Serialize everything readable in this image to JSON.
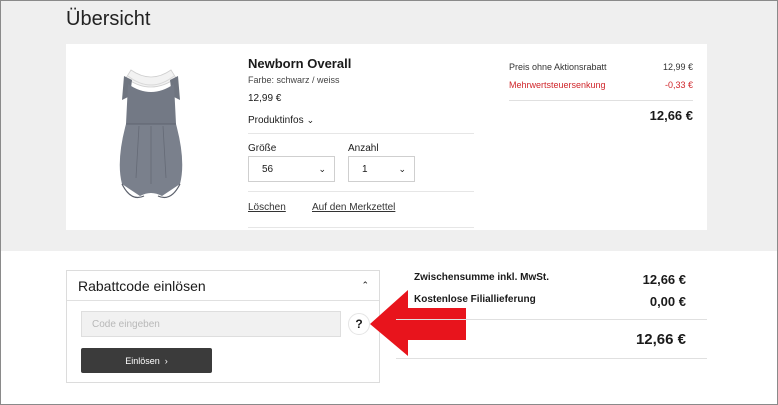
{
  "page": {
    "title": "Übersicht"
  },
  "product": {
    "name": "Newborn Overall",
    "color": "Farbe: schwarz / weiss",
    "price": "12,99 €",
    "infos_label": "Produktinfos",
    "size_label": "Größe",
    "size_value": "56",
    "qty_label": "Anzahl",
    "qty_value": "1",
    "delete_label": "Löschen",
    "wishlist_label": "Auf den Merkzettel",
    "image_icon": "baby-overall-image"
  },
  "price_breakdown": {
    "row1_label": "Preis ohne Aktionsrabatt",
    "row1_value": "12,99 €",
    "row2_label": "Mehrwertsteuersenkung",
    "row2_value": "-0,33 €",
    "total": "12,66 €"
  },
  "coupon": {
    "title": "Rabattcode einlösen",
    "placeholder": "Code eingeben",
    "help": "?",
    "button_label": "Einlösen"
  },
  "summary": {
    "subtotal_label": "Zwischensumme inkl. MwSt.",
    "subtotal_value": "12,66 €",
    "shipping_label": "Kostenlose Filiallieferung",
    "shipping_value": "0,00 €",
    "total": "12,66 €"
  },
  "colors": {
    "accent_red": "#d0262b",
    "button_dark": "#3b3b3b",
    "annotation_arrow": "#e8141c",
    "background_gray": "#efefef"
  }
}
